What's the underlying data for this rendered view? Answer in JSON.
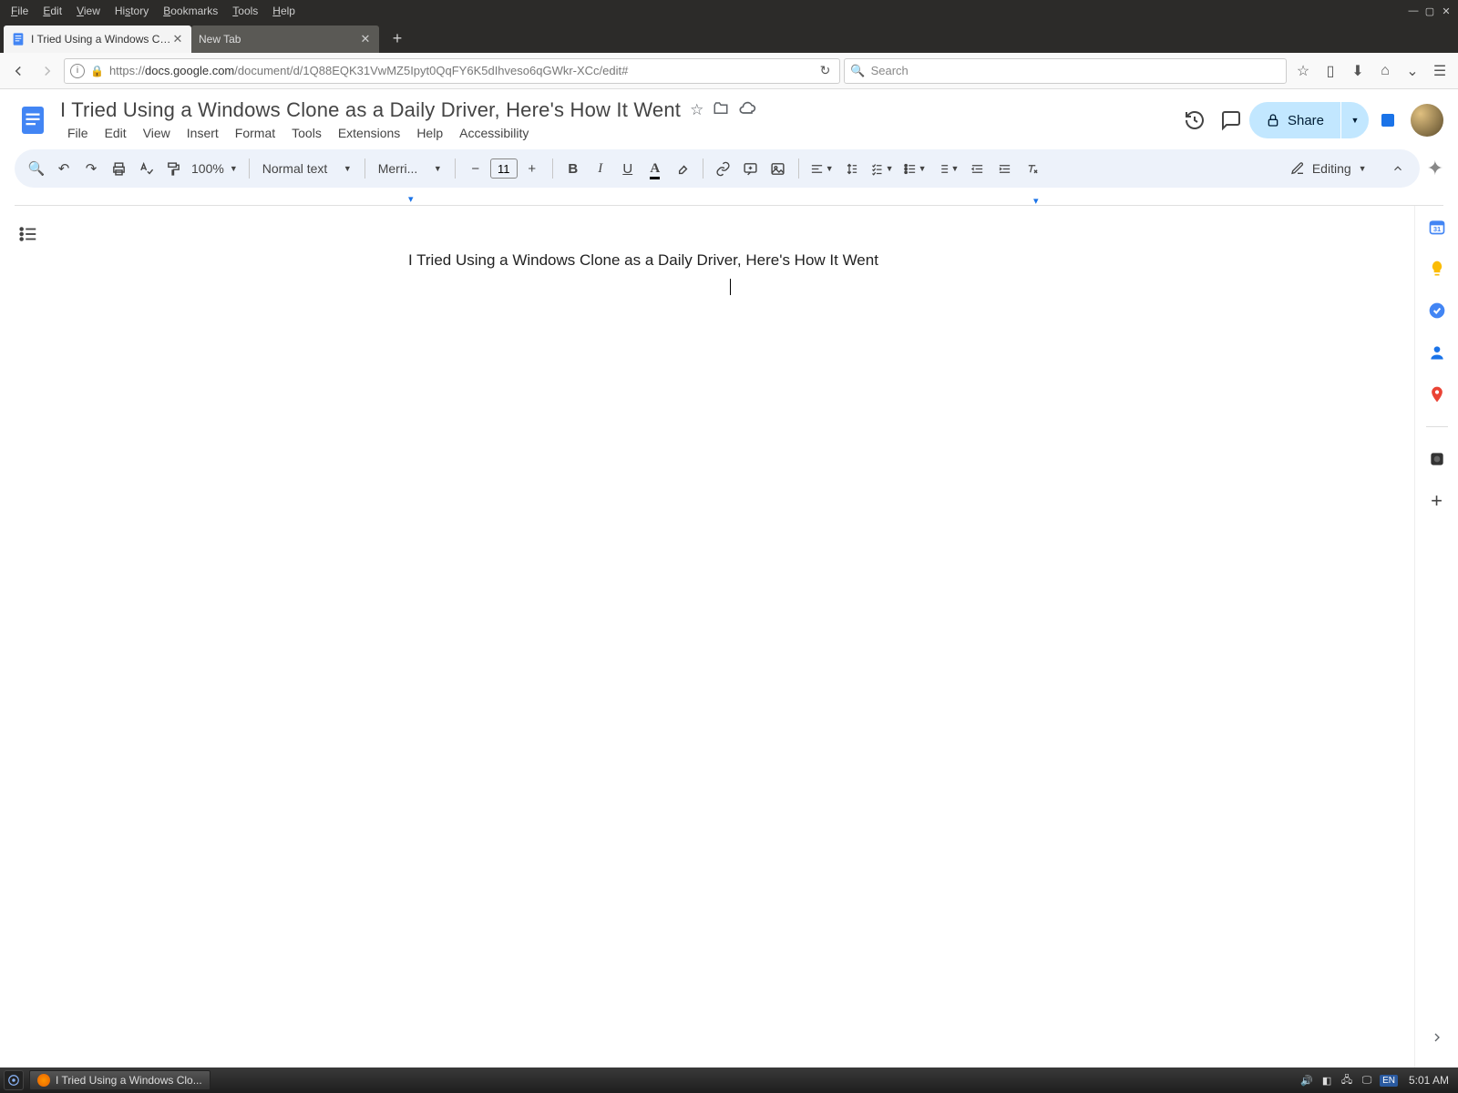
{
  "os_menu": {
    "file": "File",
    "edit": "Edit",
    "view": "View",
    "history": "History",
    "bookmarks": "Bookmarks",
    "tools": "Tools",
    "help": "Help"
  },
  "browser": {
    "tab1_title": "I Tried Using a Windows Clon...",
    "tab2_title": "New Tab",
    "url_prefix_light": "https://",
    "url_host_dark": "docs.google.com",
    "url_path_light": "/document/d/1Q88EQK31VwMZ5Ipyt0QqFY6K5dIhveso6qGWkr-XCc/edit#",
    "search_placeholder": "Search"
  },
  "docs": {
    "title": "I Tried Using a Windows Clone as a Daily Driver, Here's How It Went",
    "menus": {
      "file": "File",
      "edit": "Edit",
      "view": "View",
      "insert": "Insert",
      "format": "Format",
      "tools": "Tools",
      "extensions": "Extensions",
      "help": "Help",
      "accessibility": "Accessibility"
    },
    "share_label": "Share",
    "toolbar": {
      "zoom": "100%",
      "style": "Normal text",
      "font": "Merri...",
      "font_size": "11",
      "editing_label": "Editing"
    },
    "body_text": "I Tried Using a Windows Clone as a Daily Driver, Here's How It Went"
  },
  "taskbar": {
    "task_title": "I Tried Using a Windows Clo...",
    "lang": "EN",
    "clock": "5:01 AM"
  }
}
